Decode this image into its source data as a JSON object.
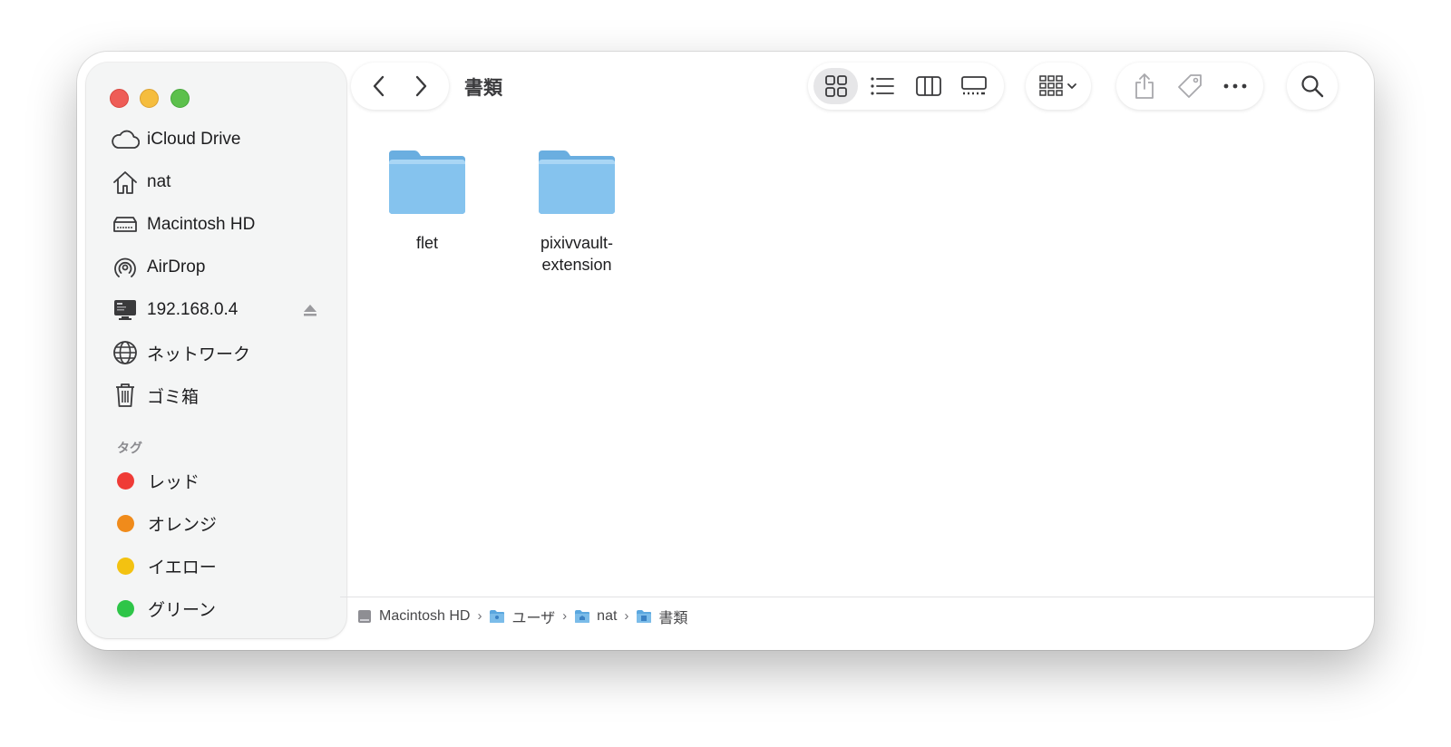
{
  "window": {
    "title": "書類"
  },
  "sidebar": {
    "favorites": [
      {
        "label": "iCloud Drive",
        "icon": "cloud-icon"
      },
      {
        "label": "nat",
        "icon": "home-icon"
      },
      {
        "label": "Macintosh HD",
        "icon": "hard-drive-icon"
      },
      {
        "label": "AirDrop",
        "icon": "airdrop-icon"
      },
      {
        "label": "192.168.0.4",
        "icon": "server-icon",
        "eject": true
      },
      {
        "label": "ネットワーク",
        "icon": "globe-icon"
      },
      {
        "label": "ゴミ箱",
        "icon": "trash-icon"
      }
    ],
    "tags_header": "タグ",
    "tags": [
      {
        "label": "レッド",
        "color": "#ef3b36"
      },
      {
        "label": "オレンジ",
        "color": "#f08b1b"
      },
      {
        "label": "イエロー",
        "color": "#f3c211"
      },
      {
        "label": "グリーン",
        "color": "#2ec548"
      }
    ]
  },
  "toolbar": {
    "view_modes": [
      "icon-view",
      "list-view",
      "column-view",
      "gallery-view"
    ],
    "active_view": "icon-view"
  },
  "files": [
    {
      "name": "flet",
      "kind": "folder"
    },
    {
      "name": "pixivvault-\nextension",
      "kind": "folder"
    }
  ],
  "pathbar": {
    "crumbs": [
      {
        "label": "Macintosh HD",
        "icon": "disk-icon"
      },
      {
        "label": "ユーザ",
        "icon": "folder-icon"
      },
      {
        "label": "nat",
        "icon": "folder-icon"
      },
      {
        "label": "書類",
        "icon": "folder-icon"
      }
    ]
  }
}
